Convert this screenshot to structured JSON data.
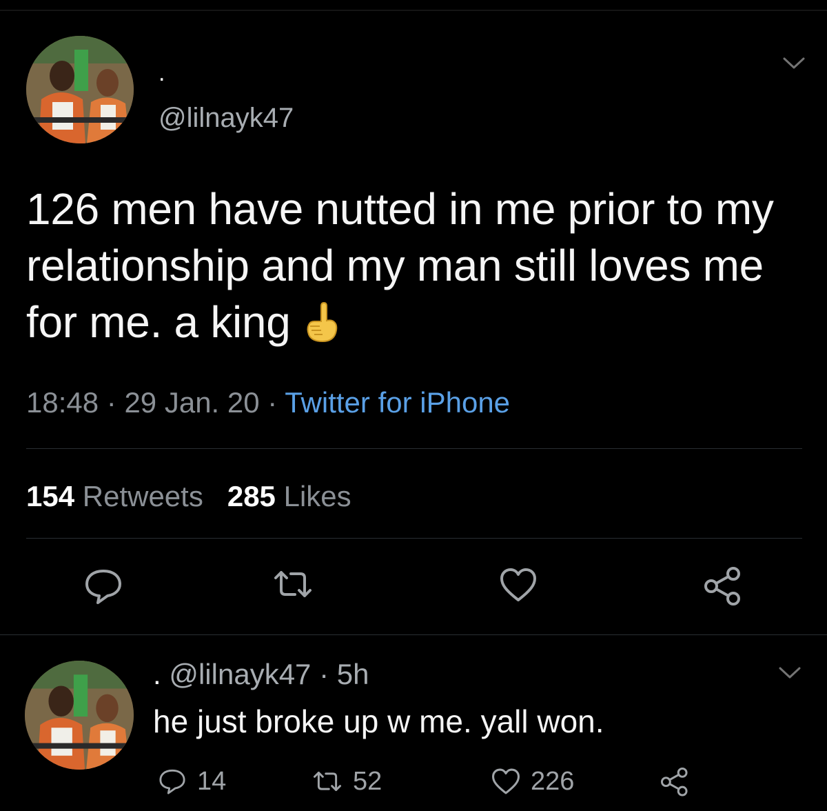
{
  "tweet": {
    "display_name": ".",
    "handle": "@lilnayk47",
    "text": "126 men have nutted in me prior to my relationship and my man still loves me for me. a king",
    "emoji": "pointing-up-hand",
    "time": "18:48",
    "date": "29 Jan. 20",
    "separator": "·",
    "source": "Twitter for iPhone",
    "retweets_count": "154",
    "retweets_label": "Retweets",
    "likes_count": "285",
    "likes_label": "Likes",
    "icons": [
      "reply-icon",
      "retweet-icon",
      "like-icon",
      "share-icon",
      "chevron-down-icon"
    ]
  },
  "reply": {
    "display_name": ".",
    "handle": "@lilnayk47",
    "separator": "·",
    "age": "5h",
    "text": "he just broke up w me. yall won.",
    "reply_count": "14",
    "retweet_count": "52",
    "like_count": "226"
  },
  "colors": {
    "background": "#000000",
    "text": "#f5f5f5",
    "muted": "#8b9096",
    "link": "#5aa0e6",
    "divider": "#2a2f33"
  }
}
